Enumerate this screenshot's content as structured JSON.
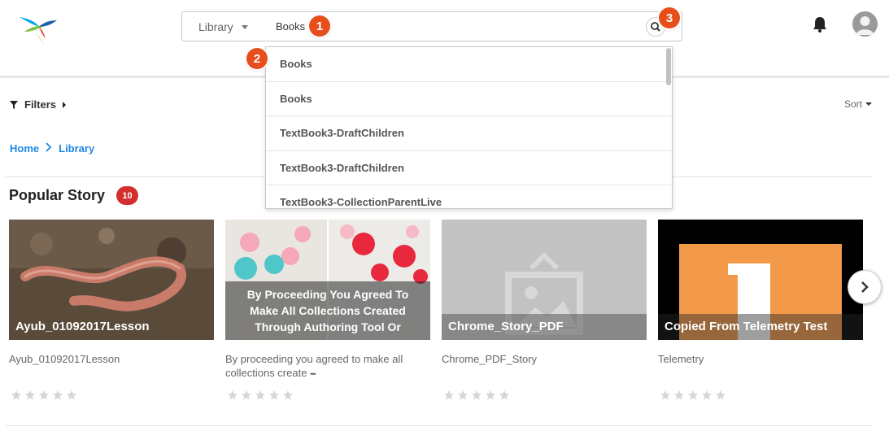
{
  "header": {
    "scope_label": "Library",
    "search_value": "Books",
    "markers": [
      "1",
      "2",
      "3"
    ]
  },
  "dropdown": {
    "suggestions": [
      "Books",
      "Books",
      "TextBook3-DraftChildren",
      "TextBook3-DraftChildren",
      "TextBook3-CollectionParentLive"
    ]
  },
  "toolbar": {
    "filters_label": "Filters",
    "sort_label": "Sort"
  },
  "breadcrumb": {
    "home": "Home",
    "library": "Library"
  },
  "section": {
    "title": "Popular Story",
    "count": "10"
  },
  "cards": [
    {
      "overlay": "Ayub_01092017Lesson",
      "desc": "Ayub_01092017Lesson",
      "rating": 0,
      "thumb": "worm-photo"
    },
    {
      "overlay": "By Proceeding You Agreed To Make All Collections Created Through Authoring Tool Or",
      "desc": "By proceeding you agreed to make all collections create",
      "more": "•••",
      "rating": 0,
      "thumb": "paper-flowers-photo"
    },
    {
      "overlay": "Chrome_Story_PDF",
      "desc": "Chrome_PDF_Story",
      "rating": 0,
      "thumb": "placeholder-image"
    },
    {
      "overlay": "Copied From Telemetry Test",
      "desc": "Telemetry",
      "rating": 0,
      "thumb": "orange-number-one"
    }
  ],
  "colors": {
    "accent_blue": "#1e88e5",
    "marker_orange": "#e84e1c",
    "badge_red": "#d32f2f"
  },
  "icons": [
    "logo-bird-icon",
    "search-icon",
    "bell-icon",
    "avatar-icon",
    "filter-icon",
    "chevron-right-icon",
    "chevron-down-icon",
    "star-icon"
  ]
}
